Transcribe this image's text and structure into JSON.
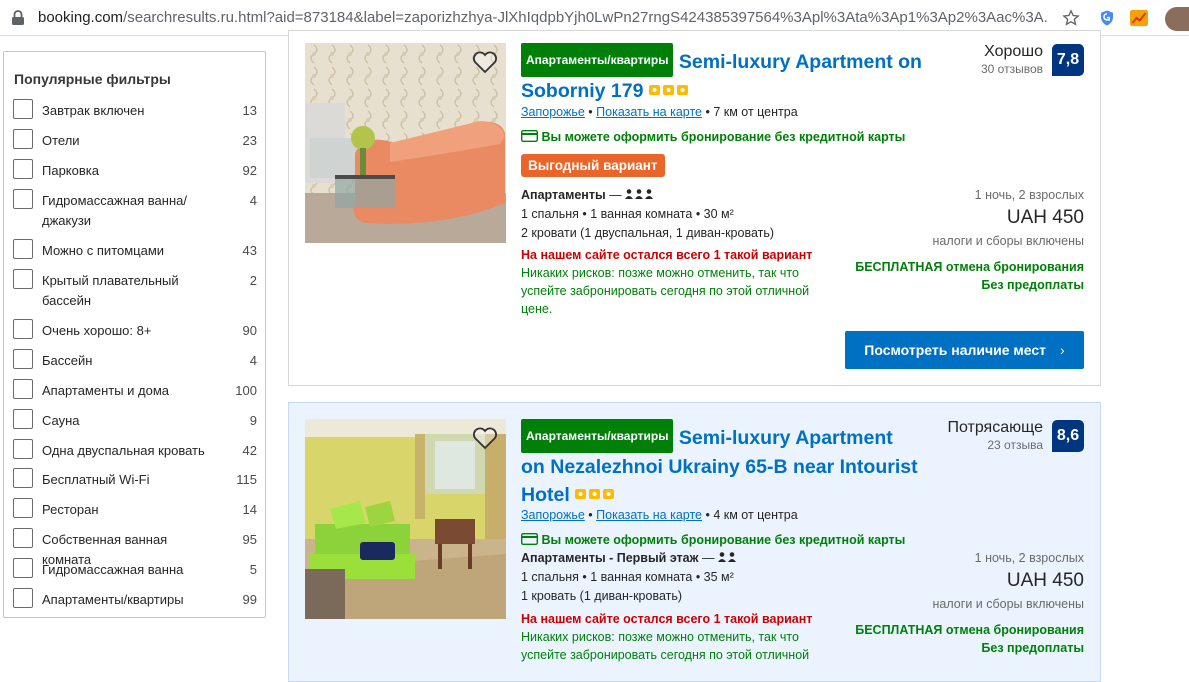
{
  "browser": {
    "url_host": "booking.com",
    "url_rest": "/searchresults.ru.html?aid=873184&label=zaporizhzhya-JlXhIqdpbYjh0LwPn27rngS424385397564%3Apl%3Ata%3Ap1%3Ap2%3Aac%3A..."
  },
  "filters": {
    "title": "Популярные фильтры",
    "items": [
      {
        "label": "Завтрак включен",
        "count": "13"
      },
      {
        "label": "Отели",
        "count": "23"
      },
      {
        "label": "Парковка",
        "count": "92"
      },
      {
        "label": "Гидромассажная ванна/ джакузи",
        "count": "4"
      },
      {
        "label": "Можно с питомцами",
        "count": "43"
      },
      {
        "label": "Крытый плавательный бассейн",
        "count": "2"
      },
      {
        "label": "Очень хорошо: 8+",
        "count": "90"
      },
      {
        "label": "Бассейн",
        "count": "4"
      },
      {
        "label": "Апартаменты и дома",
        "count": "100"
      },
      {
        "label": "Сауна",
        "count": "9"
      },
      {
        "label": "Одна двуспальная кровать",
        "count": "42"
      },
      {
        "label": "Бесплатный Wi-Fi",
        "count": "115"
      },
      {
        "label": "Ресторан",
        "count": "14"
      },
      {
        "label": "Собственная ванная комната",
        "count": "95"
      },
      {
        "label": "Гидромассажная ванна",
        "count": "5"
      },
      {
        "label": "Апартаменты/квартиры",
        "count": "99"
      }
    ]
  },
  "cards": [
    {
      "type_badge": "Апартаменты/квартиры",
      "title": "Semi-luxury Apartment on Soborniy 179",
      "city": "Запорожье",
      "map_link": "Показать на карте",
      "distance": "7 км от центра",
      "no_card": "Вы можете оформить бронирование без кредитной карты",
      "deal": "Выгодный вариант",
      "room_type": "Апартаменты",
      "room_line1": "1 спальня • 1 ванная комната • 30 м²",
      "room_line2": "2 кровати (1 двуспальная, 1 диван-кровать)",
      "warn": "На нашем сайте остался всего 1 такой вариант",
      "norisk": "Никаких рисков: позже можно отменить, так что успейте забронировать сегодня по этой отличной цене.",
      "score_label": "Хорошо",
      "reviews": "30 отзывов",
      "score": "7,8",
      "occupancy": "1 ночь, 2 взрослых",
      "price": "UAH 450",
      "tax": "налоги и сборы включены",
      "free_cancel": "БЕСПЛАТНАЯ отмена бронирования",
      "no_prepay": "Без предоплаты",
      "cta": "Посмотреть наличие мест"
    },
    {
      "type_badge": "Апартаменты/квартиры",
      "title": "Semi-luxury Apartment on Nezalezhnoi Ukrainy 65-B near Intourist Hotel",
      "city": "Запорожье",
      "map_link": "Показать на карте",
      "distance": "4 км от центра",
      "no_card": "Вы можете оформить бронирование без кредитной карты",
      "room_type": "Апартаменты - Первый этаж",
      "room_line1": "1 спальня • 1 ванная комната • 35 м²",
      "room_line2": "1 кровать (1 диван-кровать)",
      "warn": "На нашем сайте остался всего 1 такой вариант",
      "norisk": "Никаких рисков: позже можно отменить, так что успейте забронировать сегодня по этой отличной",
      "score_label": "Потрясающе",
      "reviews": "23 отзыва",
      "score": "8,6",
      "occupancy": "1 ночь, 2 взрослых",
      "price": "UAH 450",
      "tax": "налоги и сборы включены",
      "free_cancel": "БЕСПЛАТНАЯ отмена бронирования",
      "no_prepay": "Без предоплаты"
    }
  ],
  "icons": {
    "lock": "lock-icon",
    "star_bookmark": "star-icon",
    "ext1": "shield-extension-icon",
    "ext2": "chart-extension-icon",
    "heart": "heart-icon",
    "chevron": "chevron-right-icon",
    "card": "credit-card-icon",
    "person": "person-icon"
  },
  "colors": {
    "link_blue": "#0071c2",
    "green": "#008009",
    "score_navy": "#003580",
    "deal_orange": "#e9652a",
    "warn_red": "#cc0000"
  }
}
